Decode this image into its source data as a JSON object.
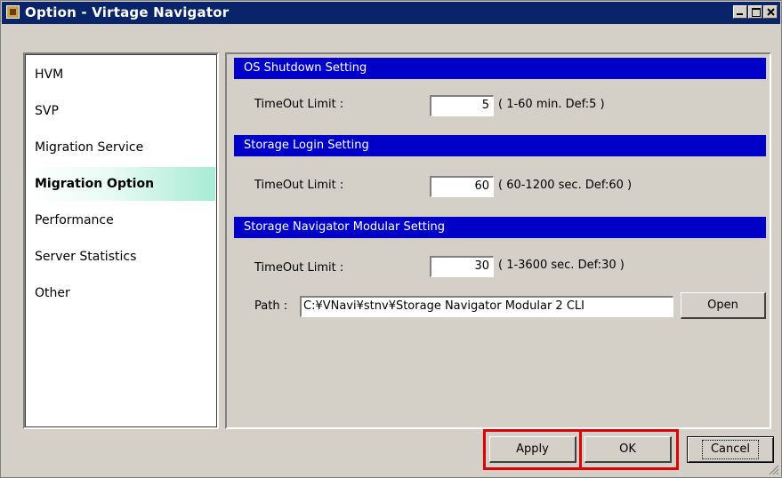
{
  "window": {
    "title": "Option - Virtage Navigator",
    "icon": "app-cube-icon",
    "controls": [
      "minimize-icon",
      "maximize-icon",
      "close-icon"
    ]
  },
  "sidebar": {
    "items": [
      {
        "label": "HVM",
        "selected": false
      },
      {
        "label": "SVP",
        "selected": false
      },
      {
        "label": "Migration Service",
        "selected": false
      },
      {
        "label": "Migration Option",
        "selected": true
      },
      {
        "label": "Performance",
        "selected": false
      },
      {
        "label": "Server Statistics",
        "selected": false
      },
      {
        "label": "Other",
        "selected": false
      }
    ]
  },
  "sections": {
    "os_shutdown": {
      "title": "OS Shutdown Setting",
      "timeout_label": "TimeOut Limit :",
      "timeout_value": "5",
      "hint": "( 1-60 min. Def:5 )"
    },
    "storage_login": {
      "title": "Storage Login Setting",
      "timeout_label": "TimeOut Limit :",
      "timeout_value": "60",
      "hint": "( 60-1200 sec. Def:60 )"
    },
    "snm": {
      "title": "Storage Navigator Modular Setting",
      "timeout_label": "TimeOut Limit :",
      "timeout_value": "30",
      "hint": "( 1-3600 sec. Def:30 )",
      "path_label": "Path :",
      "path_value": "C:¥VNavi¥stnv¥Storage Navigator Modular 2 CLI",
      "open_label": "Open"
    }
  },
  "footer": {
    "apply_label": "Apply",
    "ok_label": "OK",
    "cancel_label": "Cancel"
  },
  "colors": {
    "title_bar": "#0a246a",
    "section_header": "#0000c8",
    "selected_item": "#a7ebd5",
    "highlight_box": "#e00000"
  }
}
